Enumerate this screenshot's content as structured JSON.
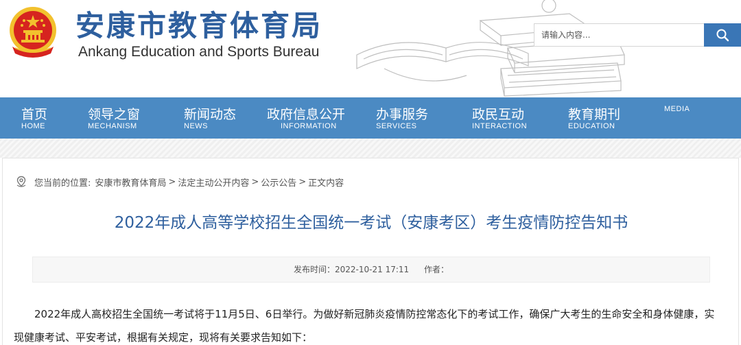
{
  "header": {
    "site_title": "安康市教育体育局",
    "site_subtitle": "Ankang Education and Sports Bureau"
  },
  "search": {
    "placeholder": "请输入内容..."
  },
  "nav": {
    "items": [
      {
        "zh": "首页",
        "en": "HOME"
      },
      {
        "zh": "领导之窗",
        "en": "MECHANISM"
      },
      {
        "zh": "新闻动态",
        "en": "NEWS"
      },
      {
        "zh": "政府信息公开",
        "en": "INFORMATION"
      },
      {
        "zh": "办事服务",
        "en": "SERVICES"
      },
      {
        "zh": "政民互动",
        "en": "INTERACTION"
      },
      {
        "zh": "教育期刊",
        "en": "EDUCATION"
      },
      {
        "zh": "",
        "en": "MEDIA"
      }
    ]
  },
  "breadcrumb": {
    "prefix": "您当前的位置:",
    "items": [
      "安康市教育体育局",
      "法定主动公开内容",
      "公示公告",
      "正文内容"
    ],
    "separator": ">"
  },
  "article": {
    "title": "2022年成人高等学校招生全国统一考试（安康考区）考生疫情防控告知书",
    "publish_label": "发布时间：",
    "publish_time": "2022-10-21 17:11",
    "author_label": "作者：",
    "paragraph": "2022年成人高校招生全国统一考试将于11月5日、6日举行。为做好新冠肺炎疫情防控常态化下的考试工作，确保广大考生的生命安全和身体健康，实现健康考试、平安考试，根据有关规定，现将有关要求告知如下："
  },
  "colors": {
    "brand_blue": "#2e5f9e",
    "nav_bg": "#4b8ac3",
    "search_btn": "#3a76b6",
    "emblem_red": "#d6241f",
    "emblem_gold": "#f2c12e"
  },
  "icons": {
    "search": "search-icon",
    "location": "location-pin-icon",
    "emblem": "national-emblem"
  }
}
